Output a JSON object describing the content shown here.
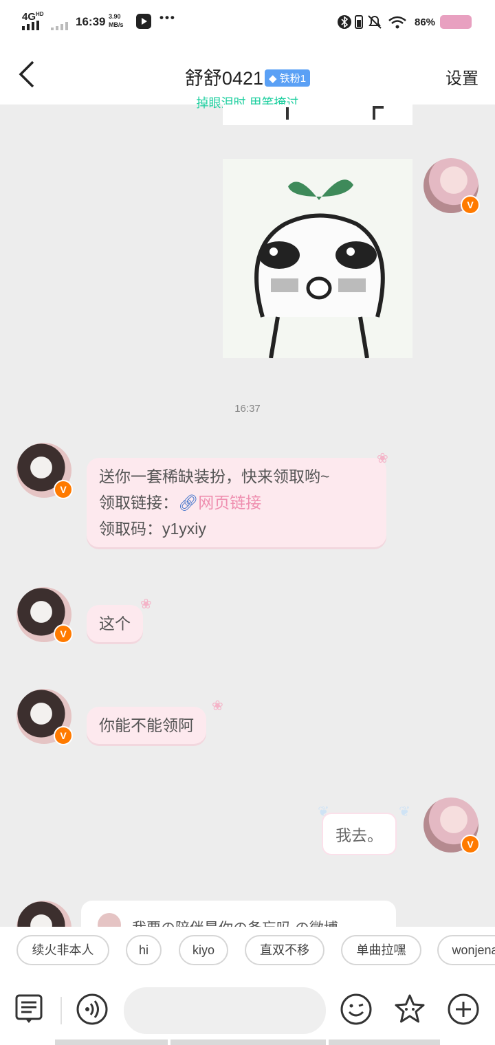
{
  "status": {
    "network": "4G",
    "network_sup": "HD",
    "time": "16:39",
    "speed_value": "3.90",
    "speed_unit": "MB/s",
    "battery": "86%",
    "battery_color": "#e8a0c0"
  },
  "header": {
    "title": "舒舒0421",
    "badge": "铁粉1",
    "subtitle": "掉眼泪时 用笑掩过",
    "settings": "设置"
  },
  "chat": {
    "timestamp": "16:37",
    "gift_msg": {
      "line1": "送你一套稀缺装扮，快来领取哟~",
      "link_label": "领取链接：",
      "link_text": "网页链接",
      "code_label": "领取码：y1yxiy"
    },
    "msg_this": "这个",
    "msg_can_you": "你能不能领阿",
    "msg_me": "我去。",
    "partial": "我要の陪伴是你の备忘吗 の微博"
  },
  "quick_replies": [
    "续火非本人",
    "hi",
    "kiyo",
    "直双不移",
    "单曲拉嘿",
    "wonjena"
  ],
  "input": {
    "placeholder": ""
  }
}
